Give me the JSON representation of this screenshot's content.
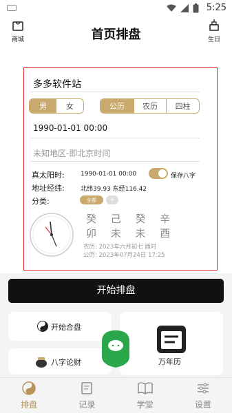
{
  "statusbar": {
    "time": "5:25"
  },
  "header": {
    "title": "首页排盘",
    "left_label": "商城",
    "right_label": "生日"
  },
  "form": {
    "name_value": "多多软件站",
    "gender": [
      "男",
      "女"
    ],
    "calendar": [
      "公历",
      "农历",
      "四柱"
    ],
    "datetime_value": "1990-01-01 00:00",
    "place_placeholder": "未知地区-即北京时间",
    "solar_time_label": "真太阳时:",
    "solar_time_value": "1990-01-01 00:00",
    "save_bazi_label": "保存八字",
    "coords_label": "地址经纬:",
    "coords_value": "北纬39.93 东经116.42",
    "category_label": "分类:",
    "category_all": "全部",
    "category_add": "+"
  },
  "bazi": {
    "stems": "癸 己 癸 辛",
    "branches": "卯 未 未 酉",
    "lunar": "农历: 2023年六月初七 酉时",
    "solar": "公历: 2023年07月24日 17:25"
  },
  "start_button": "开始排盘",
  "cards": {
    "he_pan": "开始合盘",
    "lun_cai": "八字论财",
    "wan_nian_li": "万年历"
  },
  "nav": [
    "排盘",
    "记录",
    "学堂",
    "设置"
  ],
  "colors": {
    "accent": "#c9a96e",
    "highlight_box": "#e0262b"
  }
}
